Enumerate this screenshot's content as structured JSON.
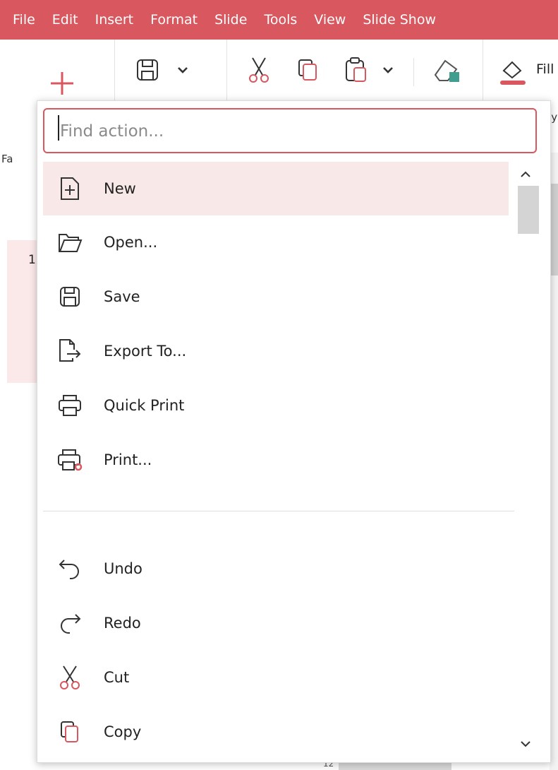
{
  "menu_bar": {
    "items": [
      "File",
      "Edit",
      "Insert",
      "Format",
      "Slide",
      "Tools",
      "View",
      "Slide Show"
    ]
  },
  "ribbon": {
    "fill_label": "Fill",
    "partial_label_left": "Fa",
    "partial_label_right": "ay"
  },
  "sidebar": {
    "slide_number": "1"
  },
  "bottom": {
    "ruler_text": "12"
  },
  "find_action": {
    "placeholder": "Find action...",
    "value": ""
  },
  "actions": [
    {
      "label": "New",
      "icon": "new-document-icon",
      "selected": true
    },
    {
      "label": "Open...",
      "icon": "folder-open-icon"
    },
    {
      "label": "Save",
      "icon": "save-icon"
    },
    {
      "label": "Export To...",
      "icon": "export-icon"
    },
    {
      "label": "Quick Print",
      "icon": "printer-icon"
    },
    {
      "label": "Print...",
      "icon": "print-settings-icon"
    },
    {
      "label": "Undo",
      "icon": "undo-icon"
    },
    {
      "label": "Redo",
      "icon": "redo-icon"
    },
    {
      "label": "Cut",
      "icon": "cut-icon"
    },
    {
      "label": "Copy",
      "icon": "copy-icon"
    }
  ],
  "colors": {
    "accent": "#d9575e",
    "selection_bg": "#f9e8e8"
  }
}
